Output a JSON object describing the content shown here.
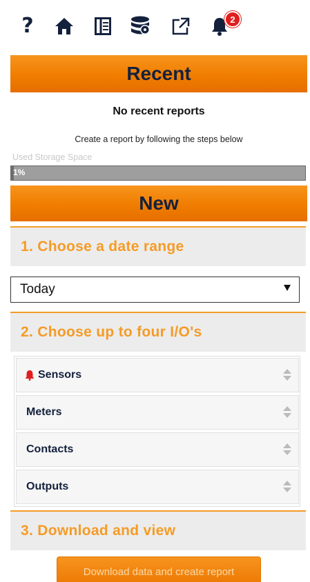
{
  "toolbar": {
    "icons": [
      "help-icon",
      "home-icon",
      "panel-icon",
      "database-icon",
      "external-link-icon",
      "bell-icon"
    ],
    "help_glyph": "?",
    "notification_count": "2",
    "icon_color": "#14213d",
    "badge_color": "#e01e1e"
  },
  "recent": {
    "title": "Recent",
    "empty_text": "No recent reports",
    "hint": "Create a report by following the steps below"
  },
  "storage": {
    "label": "Used Storage Space",
    "percent_text": "1%",
    "percent": 1
  },
  "new_section": {
    "title": "New"
  },
  "steps": {
    "step1": "1. Choose a date range",
    "step2": "2. Choose up to four I/O's",
    "step3": "3. Download and view"
  },
  "date_range": {
    "selected": "Today"
  },
  "io_types": [
    {
      "label": "Sensors",
      "icon": "alarm-bell-icon",
      "icon_color": "#e01e1e"
    },
    {
      "label": "Meters"
    },
    {
      "label": "Contacts"
    },
    {
      "label": "Outputs"
    }
  ],
  "download_button": {
    "label": "Download data and create report"
  },
  "colors": {
    "accent": "#f59b26",
    "header_orange": "#f07d00",
    "navy": "#14213d"
  }
}
